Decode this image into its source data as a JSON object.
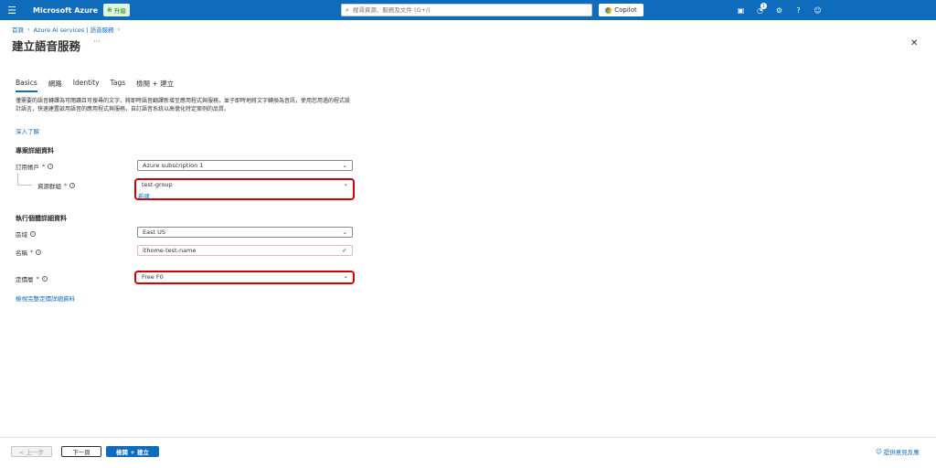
{
  "topbar": {
    "menu_icon": "hamburger-icon",
    "brand": "Microsoft Azure",
    "upgrade_label": "升級",
    "search_placeholder": "搜尋資源、服務及文件 (G+/)",
    "copilot_label": "Copilot",
    "notification_count": "1",
    "icons": [
      "cloud-shell-icon",
      "notifications-icon",
      "settings-icon",
      "help-icon",
      "feedback-icon"
    ]
  },
  "breadcrumb": {
    "items": [
      "首頁",
      "Azure AI services | 語音服務"
    ]
  },
  "page": {
    "title": "建立語音服務",
    "more_label": "···",
    "close_icon": "close-icon"
  },
  "tabs": [
    "Basics",
    "網路",
    "Identity",
    "Tags",
    "檢閱 + 建立"
  ],
  "active_tab": "Basics",
  "description": "僅需要的語音轉譯為可閱讀且可搜尋的文字，將即時語音翻譯新增至應用程式與服務，並于即時地將文字轉換為音訊，使用您用過的程式設計語言，快速建置啟用語音的應用程式與服務，自訂語音系統以高億化特定案例的品質。",
  "learn_more": "深入了解",
  "project_section": {
    "heading": "專案詳細資料",
    "subscription_label": "訂用帳戶",
    "subscription_value": "Azure subscription 1",
    "resource_group_label": "資源群組",
    "resource_group_value": "test-group",
    "create_new": "新建"
  },
  "instance_section": {
    "heading": "執行個體詳細資料",
    "region_label": "區域",
    "region_value": "East US",
    "name_label": "名稱",
    "name_value": "ithome-test-name"
  },
  "pricing": {
    "label": "定價層",
    "value": "Free F0",
    "details_link": "檢視完整定價詳細資料"
  },
  "required_marker": "*",
  "footer": {
    "prev": "< 上一步",
    "next": "下一頁",
    "review": "檢閱 + 建立",
    "feedback": "提供意見反應"
  },
  "colors": {
    "topbar": "#0f6cbd",
    "link": "#0f6cbd",
    "highlight": "#d40000",
    "required": "#a4262c"
  }
}
